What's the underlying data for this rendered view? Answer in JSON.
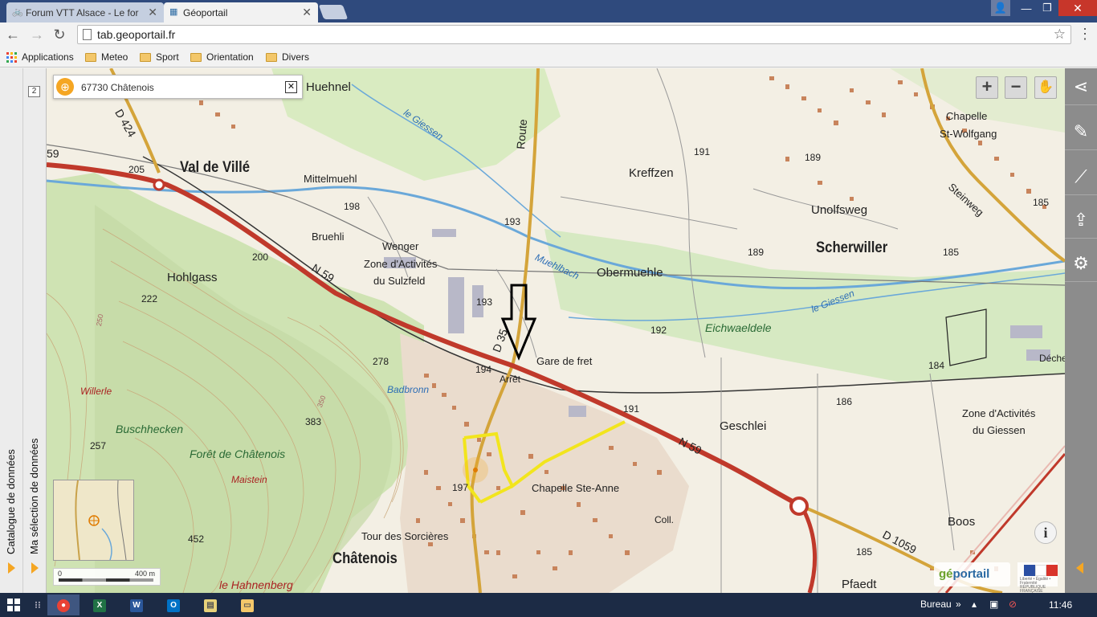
{
  "browser": {
    "tabs": [
      {
        "title": "Forum VTT Alsace - Le for",
        "active": false
      },
      {
        "title": "Géoportail",
        "active": true
      }
    ],
    "url": "tab.geoportail.fr",
    "bookmarks": {
      "apps": "Applications",
      "folders": [
        "Meteo",
        "Sport",
        "Orientation",
        "Divers"
      ]
    }
  },
  "sidepanel": {
    "badge": "2",
    "catalog": "Catalogue de données",
    "selection": "Ma sélection de données"
  },
  "search": {
    "value": "67730 Châtenois"
  },
  "map": {
    "towns": {
      "chatenois": "Châtenois",
      "scherwiller": "Scherwiller",
      "valdeville": "Val de Villé"
    },
    "places": {
      "huehnel": "Huehnel",
      "mittelmuehl": "Mittelmuehl",
      "kreffzen": "Kreffzen",
      "unolfsweg": "Unolfsweg",
      "bruehli": "Bruehli",
      "wenger": "Wenger",
      "zone1": "Zone d'Activités",
      "zone1b": "du Sulzfeld",
      "hohlgass": "Hohlgass",
      "obermuehle": "Obermuehle",
      "eichwaeldele": "Eichwaeldele",
      "chapelle1": "Chapelle",
      "chapelle1b": "St-Wolfgang",
      "steinweg": "Steinweg",
      "geschlei": "Geschlei",
      "zone2": "Zone d'Activités",
      "zone2b": "du Giessen",
      "boos": "Boos",
      "pfaedt": "Pfaedt",
      "chapelle2": "Chapelle Ste-Anne",
      "tour": "Tour des Sorcières",
      "badbronn": "Badbronn",
      "garefret": "Gare de fret",
      "arret": "Arrêt",
      "dechet": "Déchet.",
      "coll": "Coll.",
      "willerle": "Willerle",
      "buschhecken": "Buschhecken",
      "foret": "Forêt de Châtenois",
      "maistein": "Maistein",
      "hahnenberg": "le Hahnenberg"
    },
    "rivers": {
      "giessen1": "le Giessen",
      "giessen2": "le Giessen",
      "muehlbach": "Muehlbach"
    },
    "roads": {
      "d424": "D 424",
      "n59a": "N 59",
      "n59b": "N 59",
      "n59c": "59",
      "d35": "D 35",
      "route": "Route",
      "d1059": "D 1059"
    },
    "altitudes": {
      "a205": "205",
      "a200": "200",
      "a198": "198",
      "a222": "222",
      "a193a": "193",
      "a193b": "193",
      "a191a": "191",
      "a191b": "191",
      "a189a": "189",
      "a189b": "189",
      "a192": "192",
      "a194": "194",
      "a278": "278",
      "a185a": "185",
      "a185b": "185",
      "a186": "186",
      "a184": "184",
      "a185c": "185",
      "a257": "257",
      "a383": "383",
      "a452": "452",
      "a250": "250",
      "a350": "350",
      "a191c": "197"
    },
    "colors": {
      "national_road": "#c0392b",
      "departmental_road": "#d4a43a",
      "route_yellow": "#f2e51d",
      "forest": "#cfe3b3",
      "water": "#6aa8d9",
      "urban": "#c8845c"
    }
  },
  "controls": {
    "zoom_in": "+",
    "zoom_out": "−",
    "scale_start": "0",
    "scale_end": "400 m",
    "info": "i"
  },
  "logo": {
    "text_a": "gé",
    "text_b": "portail",
    "caption": "Liberté • Égalité • Fraternité RÉPUBLIQUE FRANÇAISE"
  },
  "taskbar": {
    "bureau": "Bureau",
    "clock": "11:46",
    "apps": [
      "chrome",
      "excel",
      "word",
      "outlook",
      "notes",
      "explorer"
    ]
  }
}
